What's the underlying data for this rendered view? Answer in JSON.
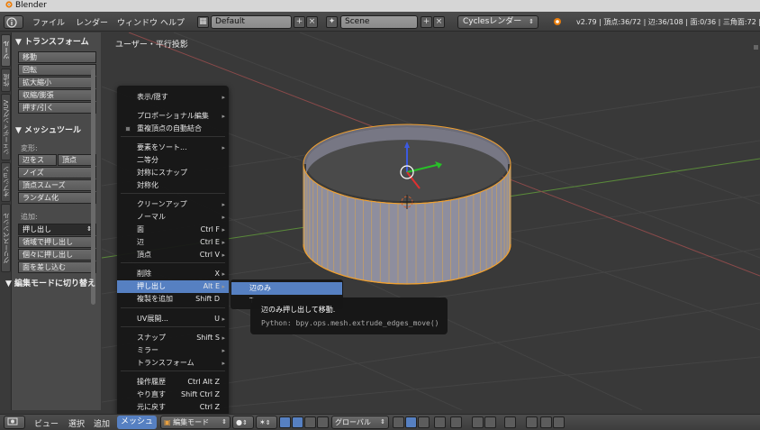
{
  "titlebar": {
    "title": "Blender"
  },
  "info_header": {
    "editor_icon": "info-icon",
    "menus": [
      "ファイル",
      "レンダー",
      "ウィンドウ",
      "ヘルプ"
    ],
    "layout_name": "Default",
    "scene_name": "Scene",
    "render_engine": "Cyclesレンダー",
    "stats": "v2.79 | 頂点:36/72 | 辺:36/108 | 面:0/36 | 三角面:72 | メモリ"
  },
  "vertical_tabs": [
    "ツール",
    "作成",
    "シェーディング/UV",
    "オプション",
    "グリースペンシル"
  ],
  "toolshelf": {
    "transform_header": "▼ トランスフォーム",
    "transform_buttons": [
      "移動",
      "回転",
      "拡大縮小",
      "収縮/膨張",
      "押す/引く"
    ],
    "mesh_tools_header": "▼ メッシュツール",
    "deform_label": "変形:",
    "deform_half": [
      "辺をス",
      "頂点"
    ],
    "deform_buttons": [
      "ノイズ",
      "頂点スムーズ",
      "ランダム化"
    ],
    "add_label": "追加:",
    "add_dropdown": "押し出し",
    "add_buttons": [
      "領域で押し出し",
      "個々に押し出し",
      "面を差し込む"
    ],
    "edit_mode_toggle": "▼ 編集モードに切り替え"
  },
  "viewport": {
    "view_label": "ユーザー・平行投影"
  },
  "menu": {
    "items": [
      {
        "label": "表示/隠す",
        "shortcut": "",
        "arrow": true
      },
      {
        "label": "プロポーショナル編集",
        "shortcut": "",
        "arrow": true
      },
      {
        "label": "重複頂点の自動結合",
        "shortcut": "",
        "arrow": false,
        "checkbox": true
      },
      {
        "label": "要素をソート...",
        "shortcut": "",
        "arrow": true
      },
      {
        "label": "二等分",
        "shortcut": "",
        "arrow": false
      },
      {
        "label": "対称にスナップ",
        "shortcut": "",
        "arrow": false
      },
      {
        "label": "対称化",
        "shortcut": "",
        "arrow": false
      },
      {
        "label": "クリーンアップ",
        "shortcut": "",
        "arrow": true
      },
      {
        "label": "ノーマル",
        "shortcut": "",
        "arrow": true
      },
      {
        "label": "面",
        "shortcut": "Ctrl F",
        "arrow": true
      },
      {
        "label": "辺",
        "shortcut": "Ctrl E",
        "arrow": true
      },
      {
        "label": "頂点",
        "shortcut": "Ctrl V",
        "arrow": true
      },
      {
        "label": "削除",
        "shortcut": "X",
        "arrow": true
      },
      {
        "label": "押し出し",
        "shortcut": "Alt E",
        "arrow": true,
        "highlight": true
      },
      {
        "label": "複製を追加",
        "shortcut": "Shift D",
        "arrow": false
      },
      {
        "label": "UV展開...",
        "shortcut": "U",
        "arrow": true
      },
      {
        "label": "スナップ",
        "shortcut": "Shift S",
        "arrow": true
      },
      {
        "label": "ミラー",
        "shortcut": "",
        "arrow": true
      },
      {
        "label": "トランスフォーム",
        "shortcut": "",
        "arrow": true
      },
      {
        "label": "操作履歴",
        "shortcut": "Ctrl Alt Z",
        "arrow": false
      },
      {
        "label": "やり直す",
        "shortcut": "Shift Ctrl Z",
        "arrow": false
      },
      {
        "label": "元に戻す",
        "shortcut": "Ctrl Z",
        "arrow": false
      }
    ]
  },
  "submenu": {
    "items": [
      {
        "label": "辺のみ",
        "highlight": true
      },
      {
        "label": "T",
        "highlight": false
      }
    ]
  },
  "tooltip": {
    "title": "辺のみ押し出して移動.",
    "python": "Python: bpy.ops.mesh.extrude_edges_move()"
  },
  "bottombar": {
    "menus": [
      "ビュー",
      "選択",
      "追加"
    ],
    "active_menu": "メッシュ",
    "mode": "編集モード",
    "orientation": "グローバル"
  },
  "colors": {
    "highlight": "#5680c2",
    "menu_bg": "#161616",
    "viewport_bg": "#393939",
    "edge_select": "#f0a030"
  }
}
